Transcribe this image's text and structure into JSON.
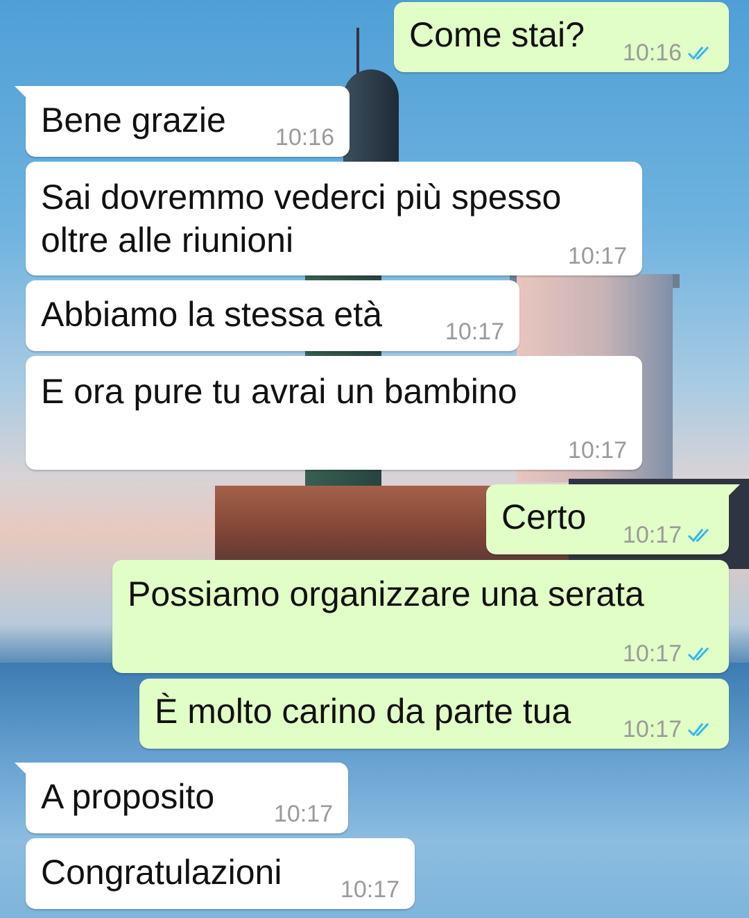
{
  "conversation": {
    "messages": [
      {
        "text": "Come stai?",
        "time": "10:16",
        "direction": "outgoing",
        "status": "read"
      },
      {
        "text": "Bene grazie",
        "time": "10:16",
        "direction": "incoming"
      },
      {
        "text": "Sai dovremmo vederci più spesso\noltre alle riunioni",
        "time": "10:17",
        "direction": "incoming"
      },
      {
        "text": "Abbiamo la stessa età",
        "time": "10:17",
        "direction": "incoming"
      },
      {
        "text": "E ora pure tu avrai un bambino",
        "time": "10:17",
        "direction": "incoming"
      },
      {
        "text": "Certo",
        "time": "10:17",
        "direction": "outgoing",
        "status": "read"
      },
      {
        "text": "Possiamo organizzare una serata",
        "time": "10:17",
        "direction": "outgoing",
        "status": "read"
      },
      {
        "text": "È molto carino da parte tua",
        "time": "10:17",
        "direction": "outgoing",
        "status": "read"
      },
      {
        "text": "A proposito",
        "time": "10:17",
        "direction": "incoming"
      },
      {
        "text": "Congratulazioni",
        "time": "10:17",
        "direction": "incoming"
      }
    ]
  },
  "colors": {
    "incoming_bubble": "#ffffff",
    "outgoing_bubble": "#e1fec6",
    "read_tick": "#34b7f1",
    "timestamp": "#9a9a9a"
  },
  "icons": {
    "read_receipt": "double-check-icon"
  }
}
